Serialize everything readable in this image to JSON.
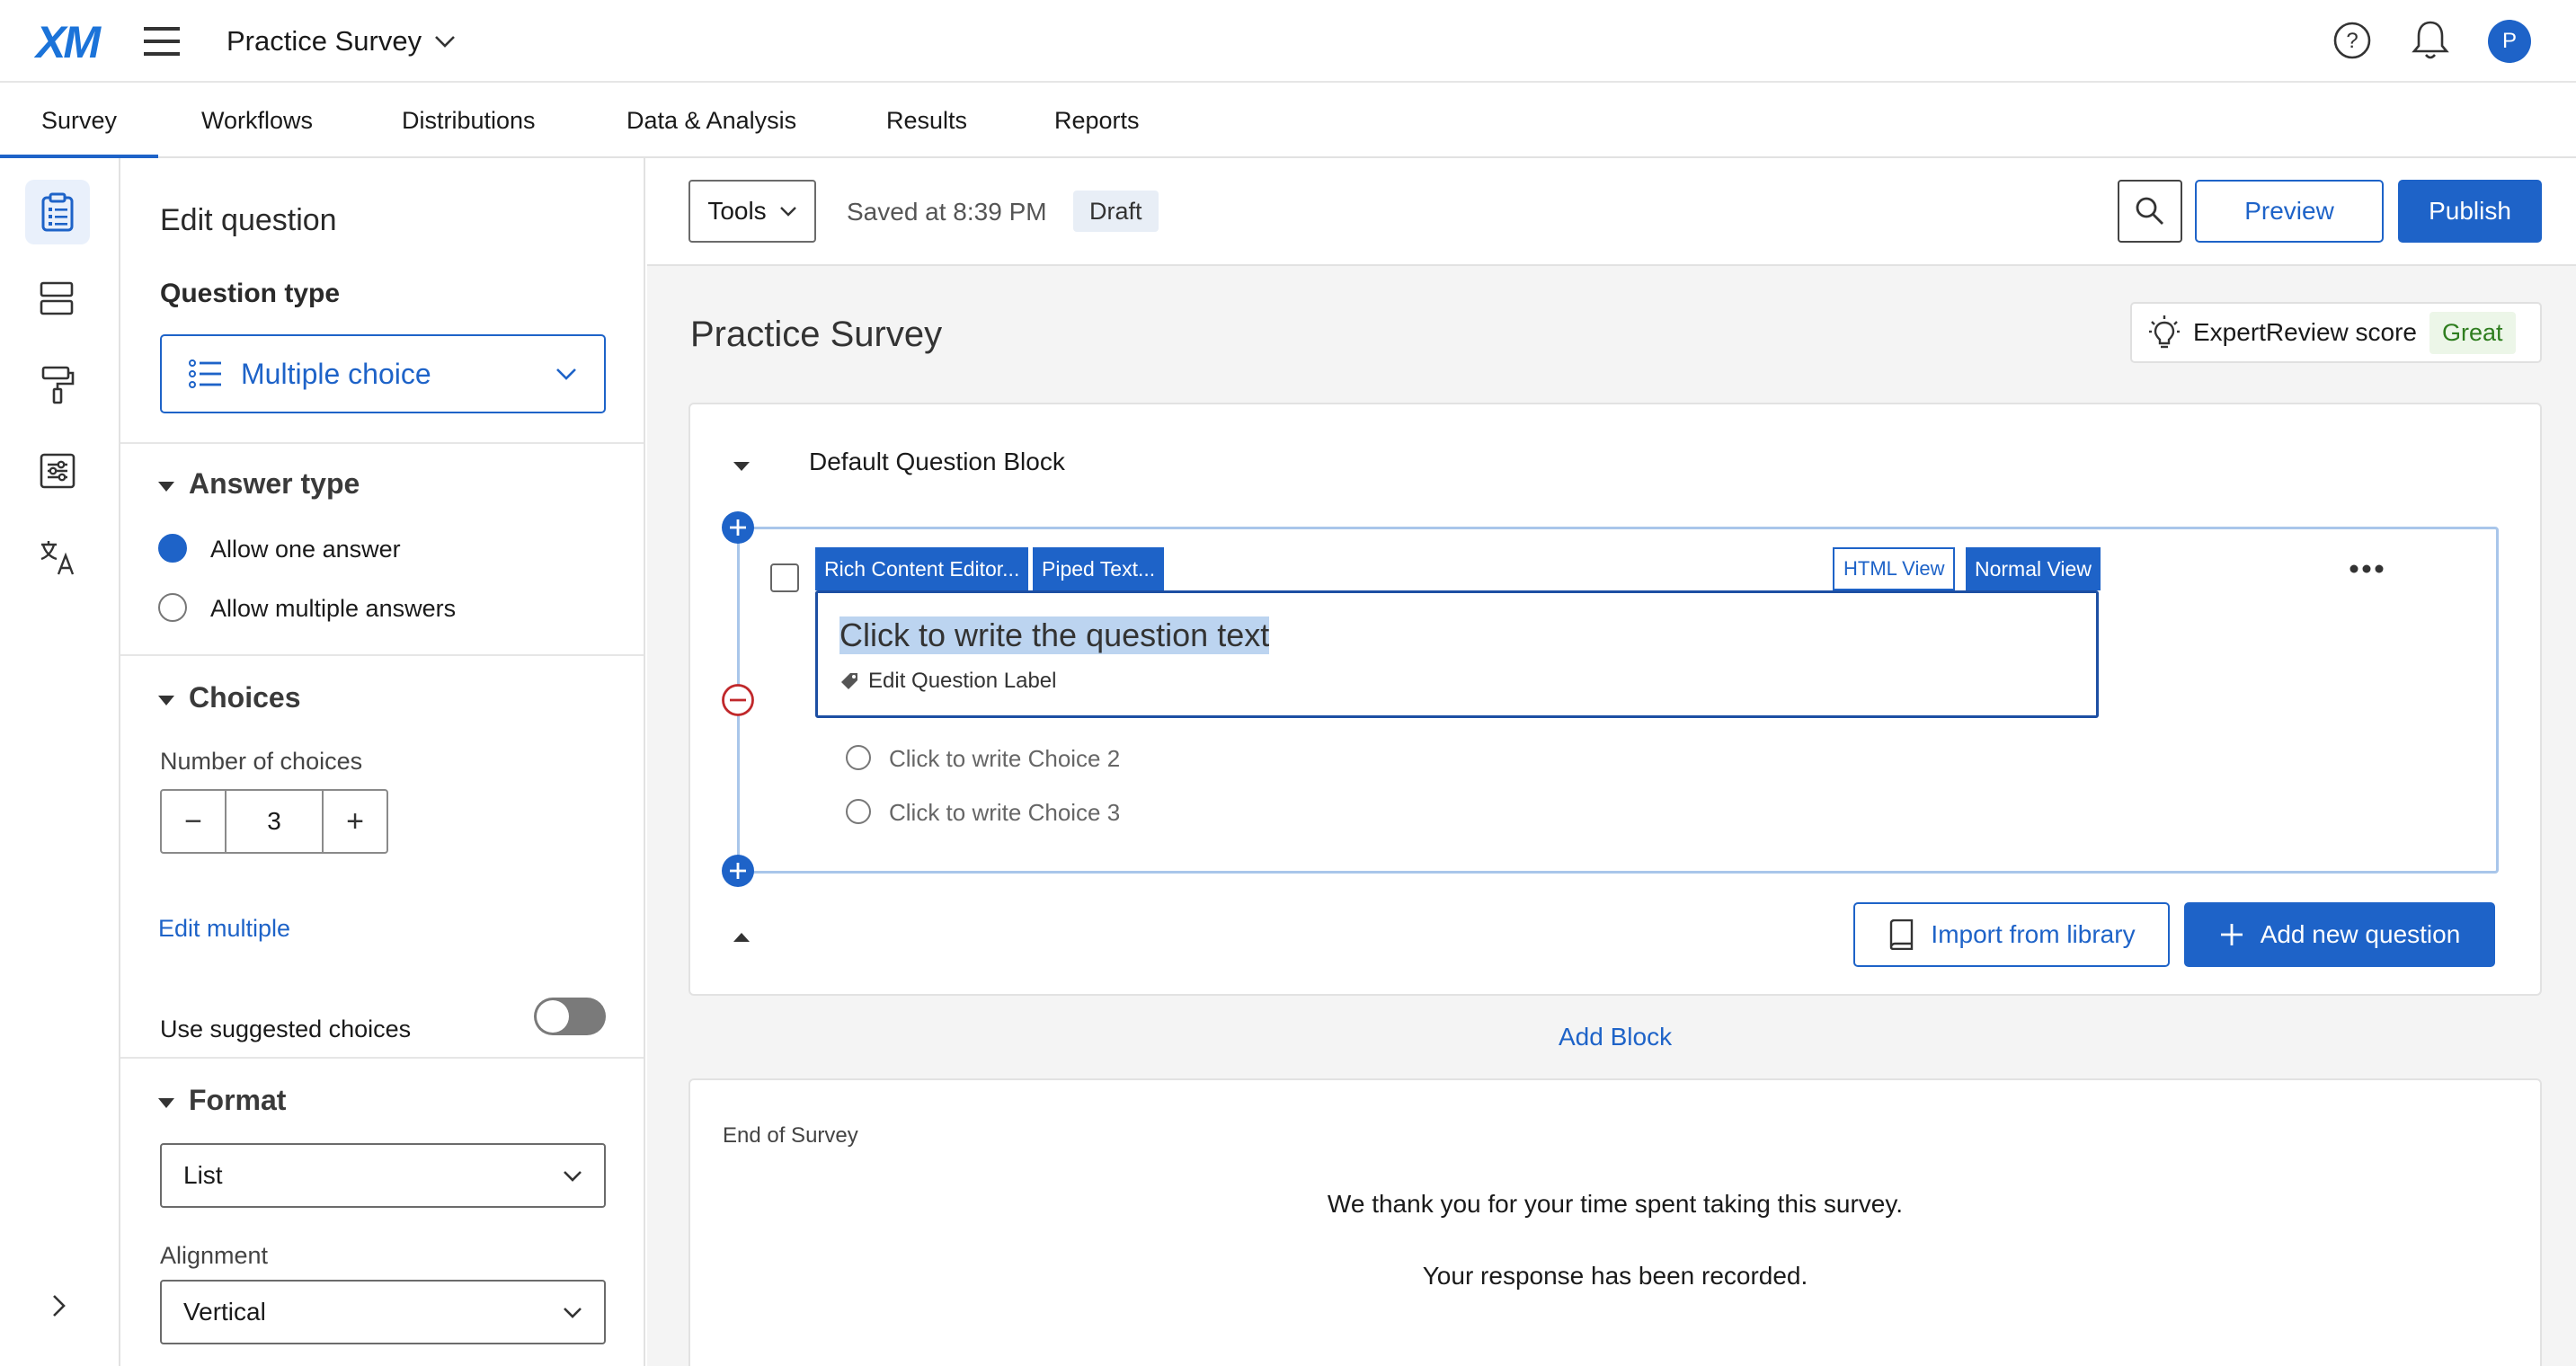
{
  "header": {
    "logo": "XM",
    "survey_name": "Practice Survey",
    "avatar_initial": "P"
  },
  "tabs": [
    "Survey",
    "Workflows",
    "Distributions",
    "Data & Analysis",
    "Results",
    "Reports"
  ],
  "panel": {
    "title": "Edit question",
    "question_type_label": "Question type",
    "question_type_value": "Multiple choice",
    "answer_type": {
      "title": "Answer type",
      "options": [
        "Allow one answer",
        "Allow multiple answers"
      ],
      "selected_index": 0
    },
    "choices": {
      "title": "Choices",
      "number_label": "Number of choices",
      "number_value": "3",
      "minus": "−",
      "plus": "+",
      "edit_multiple": "Edit multiple",
      "suggested_label": "Use suggested choices",
      "suggested_on": false
    },
    "format": {
      "title": "Format",
      "format_value": "List",
      "alignment_label": "Alignment",
      "alignment_value": "Vertical"
    }
  },
  "toolbar": {
    "tools_label": "Tools",
    "saved_text": "Saved at 8:39 PM",
    "status_badge": "Draft",
    "preview_label": "Preview",
    "publish_label": "Publish"
  },
  "survey": {
    "title": "Practice Survey",
    "expert_review_label": "ExpertReview score",
    "expert_review_score": "Great",
    "block_title": "Default Question Block",
    "editor_buttons": {
      "rich": "Rich Content Editor...",
      "piped": "Piped Text...",
      "html": "HTML View",
      "normal": "Normal View"
    },
    "question_text": "Click to write the question text",
    "edit_label": "Edit Question Label",
    "choices": [
      "Click to write Choice 2",
      "Click to write Choice 3"
    ],
    "import_label": "Import from library",
    "add_question_label": "Add new question",
    "add_block_label": "Add Block",
    "end_title": "End of Survey",
    "end_line1": "We thank you for your time spent taking this survey.",
    "end_line2": "Your response has been recorded."
  },
  "colors": {
    "accent": "#1e63c8",
    "success_text": "#2e7d1e",
    "danger": "#c0282b",
    "selection": "#bcd4f0"
  }
}
